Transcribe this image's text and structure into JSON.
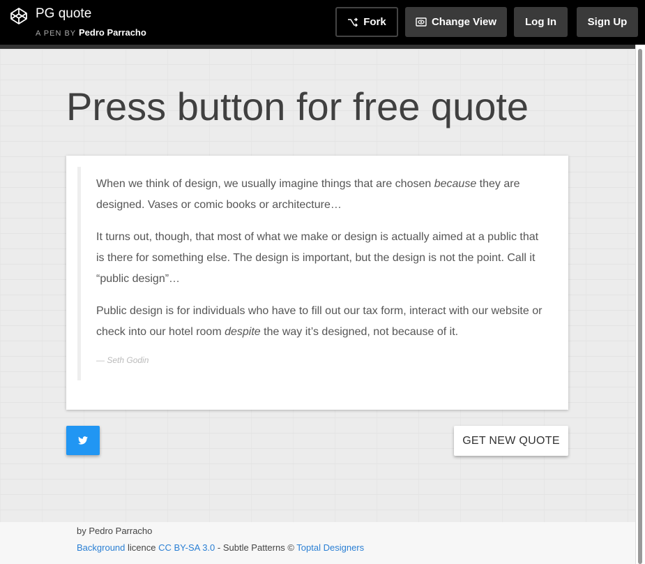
{
  "header": {
    "title": "PG quote",
    "pen_by_prefix": "A PEN BY",
    "author": "Pedro Parracho",
    "buttons": {
      "fork": "Fork",
      "change_view": "Change View",
      "login": "Log In",
      "signup": "Sign Up"
    }
  },
  "main": {
    "headline": "Press button for free quote",
    "quote": {
      "p1_a": "When we think of design, we usually imagine things that are chosen ",
      "p1_em": "because",
      "p1_b": " they are designed. Vases or comic books or architecture…",
      "p2": "It turns out, though, that most of what we make or design is actually aimed at a public that is there for something else. The design is important, but the design is not the point. Call it “public design”…",
      "p3_a": "Public design is for individuals who have to fill out our tax form, interact with our website or check into our hotel room ",
      "p3_em": "despite",
      "p3_b": " the way it’s designed, not because of it.",
      "author": "— Seth Godin"
    },
    "tweet_icon": "twitter-icon",
    "new_quote_label": "GET NEW QUOTE"
  },
  "footer": {
    "line1": "by Pedro Parracho",
    "background_link": "Background",
    "licence_text": " licence ",
    "cc_link": "CC BY-SA 3.0",
    "subtle_text": " - Subtle Patterns © ",
    "toptal_link": "Toptal Designers"
  },
  "colors": {
    "accent_blue": "#2196f3",
    "link_blue": "#2a7fd4"
  }
}
